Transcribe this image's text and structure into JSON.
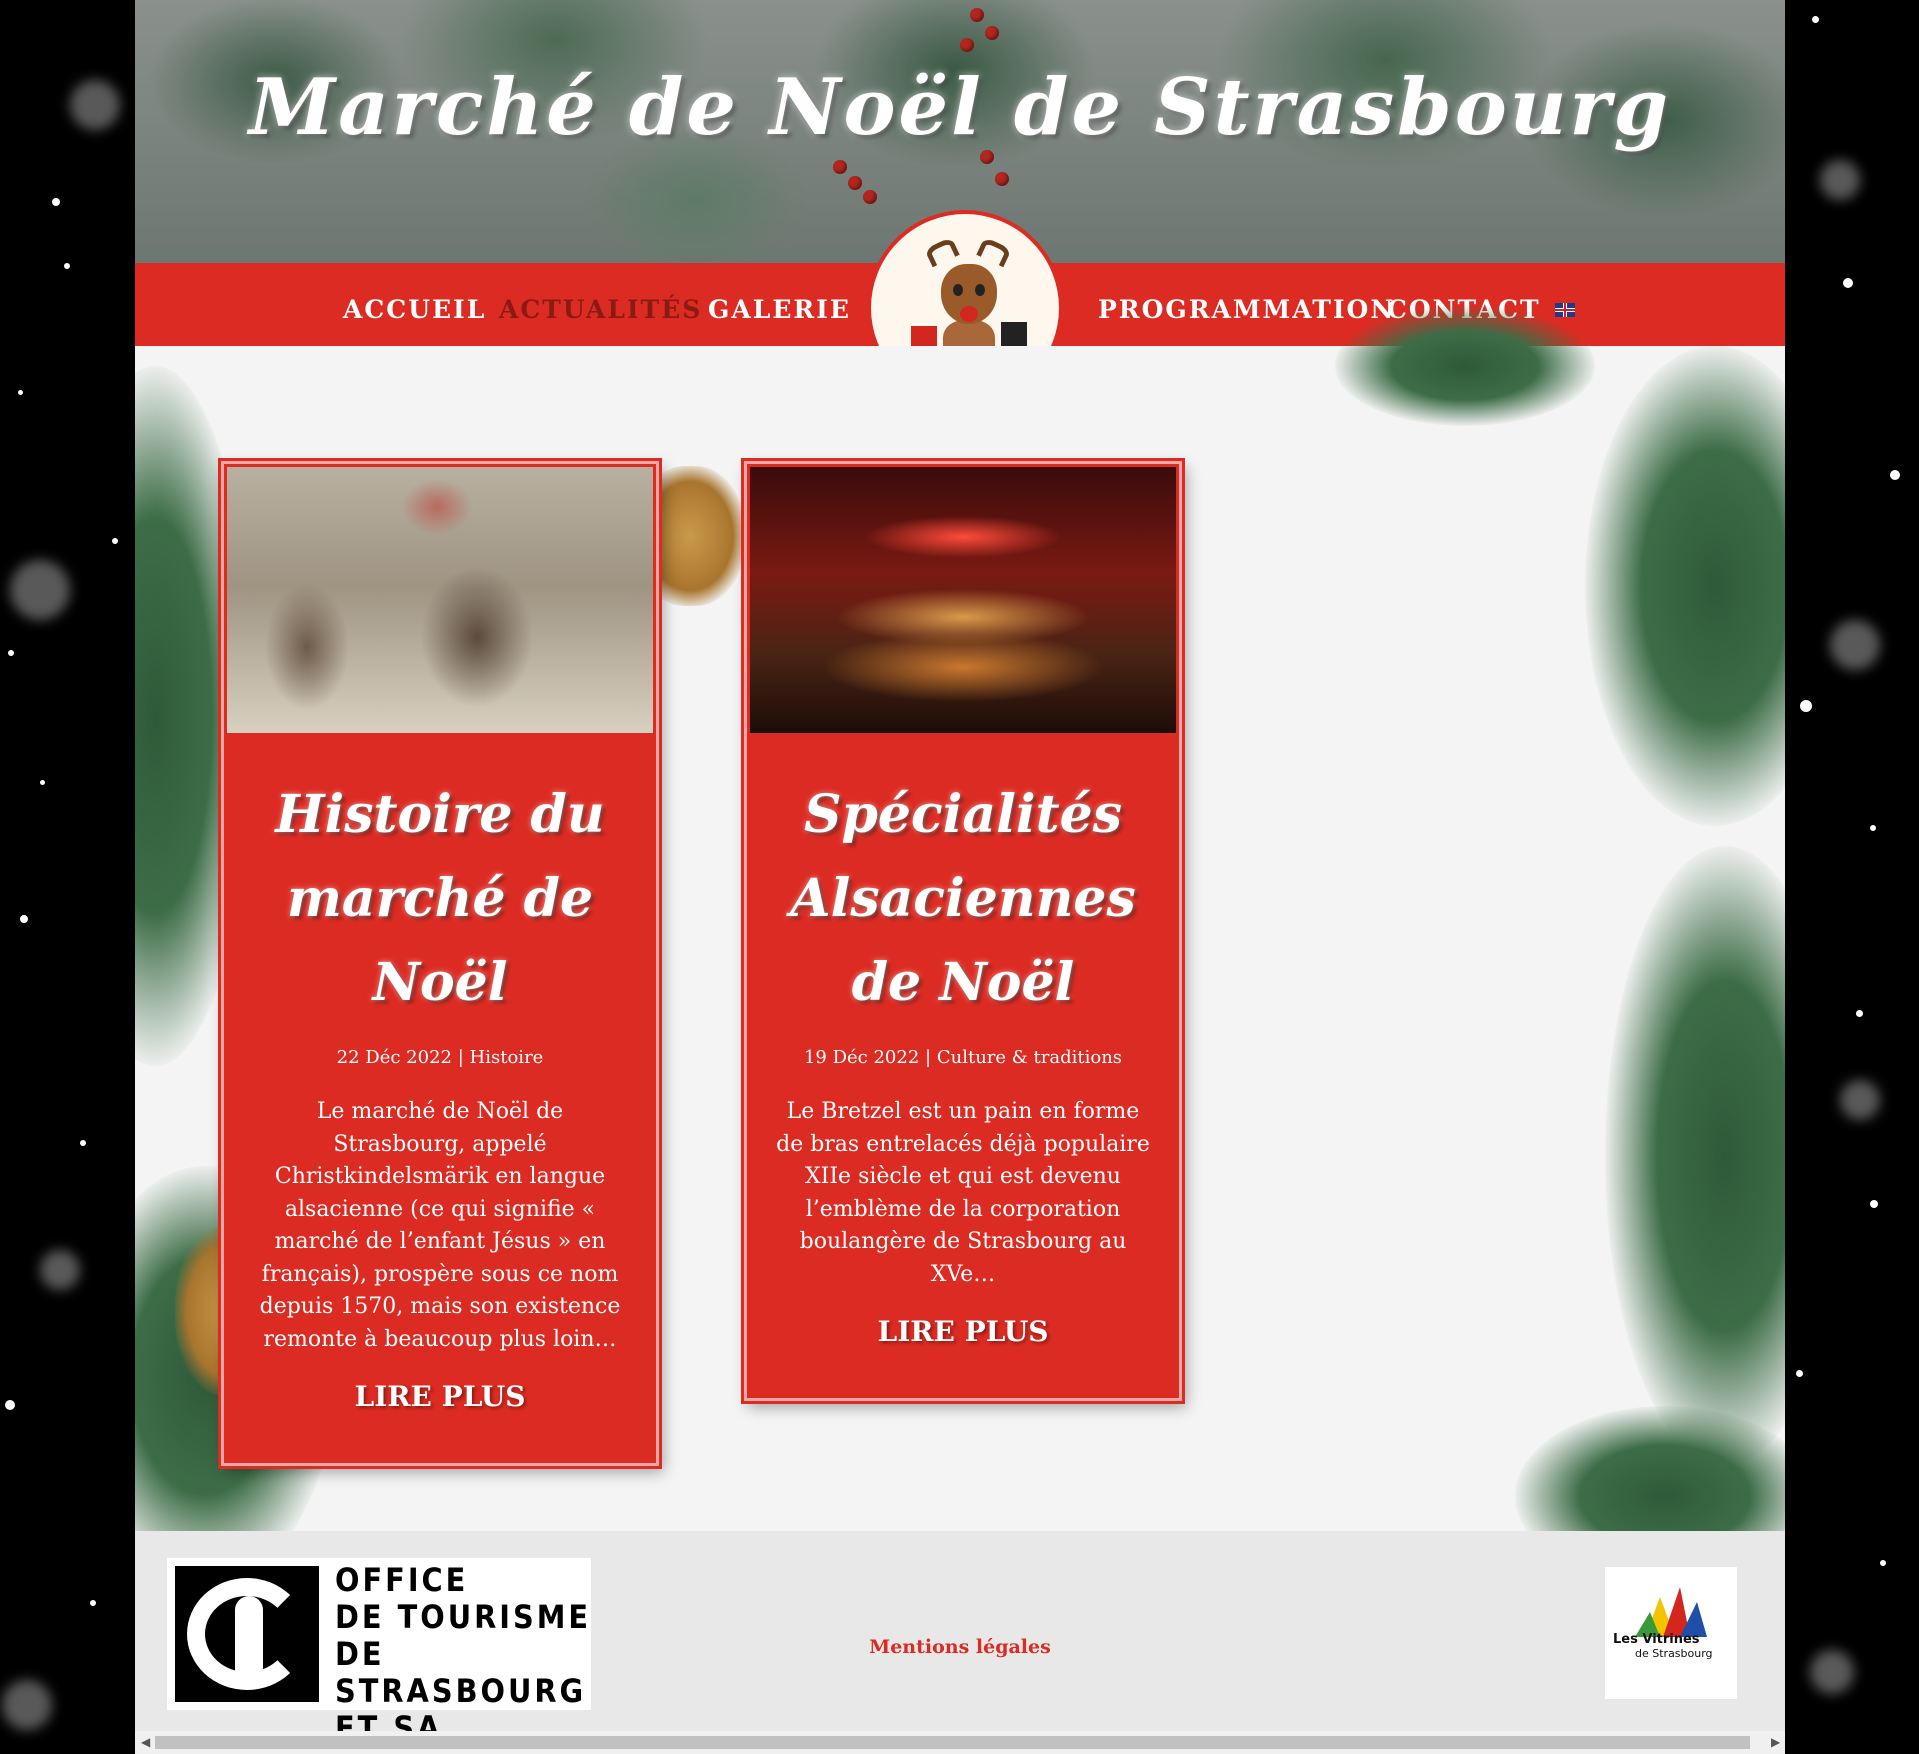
{
  "header": {
    "title": "Marché de Noël de Strasbourg"
  },
  "nav": {
    "items": [
      {
        "label": "ACCUEIL"
      },
      {
        "label": "ACTUALITÉS"
      },
      {
        "label": "GALERIE"
      },
      {
        "label": "PROGRAMMATION"
      },
      {
        "label": "CONTACT"
      }
    ],
    "active": "ACTUALITÉS",
    "language_icon": "uk-flag-icon"
  },
  "logo": {
    "icon": "reindeer-icon"
  },
  "posts": [
    {
      "title": "Histoire du marché de Noël",
      "date": "22 Déc 2022",
      "separator": "|",
      "category": "Histoire",
      "excerpt": "Le marché de Noël de Strasbourg, appelé Christkindelsmärik en langue alsacienne (ce qui signifie « marché de l’enfant Jésus » en français), prospère sous ce nom depuis 1570, mais son existence remonte à beaucoup plus loin…",
      "read_more": "LIRE PLUS"
    },
    {
      "title": "Spécialités Alsaciennes de Noël",
      "date": "19 Déc 2022",
      "separator": "|",
      "category": "Culture & traditions",
      "excerpt": "Le Bretzel est un pain en forme de bras entrelacés déjà populaire XIIe siècle et qui est devenu l’emblème de la corporation boulangère de Strasbourg au XVe…",
      "read_more": "LIRE PLUS"
    }
  ],
  "footer": {
    "tourism_logo_lines": [
      "OFFICE",
      "DE TOURISME",
      "DE STRASBOURG",
      "ET SA RÉGION"
    ],
    "legal_link": "Mentions légales",
    "partner_logo": {
      "line1": "Les Vitrines",
      "line2": "de Strasbourg"
    }
  },
  "colors": {
    "accent_red": "#dc2b22",
    "active_nav": "#8a1a14",
    "footer_bg": "#e8e8e8"
  }
}
